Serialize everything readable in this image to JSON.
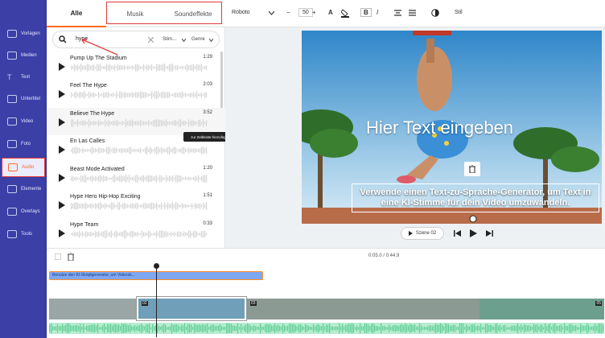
{
  "sidebar": {
    "items": [
      {
        "label": "Vorlagen",
        "icon": "template-icon"
      },
      {
        "label": "Medien",
        "icon": "media-icon"
      },
      {
        "label": "Text",
        "icon": "text-icon"
      },
      {
        "label": "Untertitel",
        "icon": "subtitle-icon"
      },
      {
        "label": "Video",
        "icon": "video-icon"
      },
      {
        "label": "Foto",
        "icon": "photo-icon"
      },
      {
        "label": "Audio",
        "icon": "audio-icon"
      },
      {
        "label": "Elemente",
        "icon": "elements-icon"
      },
      {
        "label": "Overlays",
        "icon": "overlays-icon"
      },
      {
        "label": "Tools",
        "icon": "tools-icon"
      }
    ],
    "active_index": 6
  },
  "tabs": {
    "all": "Alle",
    "music": "Musik",
    "sfx": "Soundeffekte"
  },
  "toolbar": {
    "font": "Roboto",
    "font_size": "50",
    "minus": "−",
    "plus": "+",
    "bold": "B",
    "italic": "I",
    "style_label": "Stil"
  },
  "search": {
    "value": "hype",
    "filter_mood": "Stim...",
    "filter_genre": "Genre"
  },
  "tracks": [
    {
      "title": "Pump Up The Stadium",
      "duration": "1:29"
    },
    {
      "title": "Feel The Hype",
      "duration": "2:03"
    },
    {
      "title": "Believe The Hype",
      "duration": "3:52"
    },
    {
      "title": "En Las Calles",
      "duration": "0:45"
    },
    {
      "title": "Beast Mode Activated",
      "duration": "1:20"
    },
    {
      "title": "Hype Hero Hip-Hop Exciting",
      "duration": "1:51"
    },
    {
      "title": "Hype Team",
      "duration": "0:33"
    }
  ],
  "tooltip": "zur Zeitleiste hinzufügen",
  "preview": {
    "heading": "Hier Text eingeben",
    "subtitle": "Verwende einen Text-zu-Sprache-Generator, um Text in eine KI-Stimme für dein Video umzuwandeln.",
    "scene": "Szene 02"
  },
  "timeline": {
    "time": "0:05.0 / 0:44.9",
    "text_clip": "Benutze den KI-Skriptgenerator, um Videosk...",
    "clip_numbers": [
      "02",
      "03",
      "05"
    ]
  },
  "colors": {
    "sidebar": "#3b3fa6",
    "accent": "#ff6a1f",
    "highlight": "#e23a3a"
  }
}
